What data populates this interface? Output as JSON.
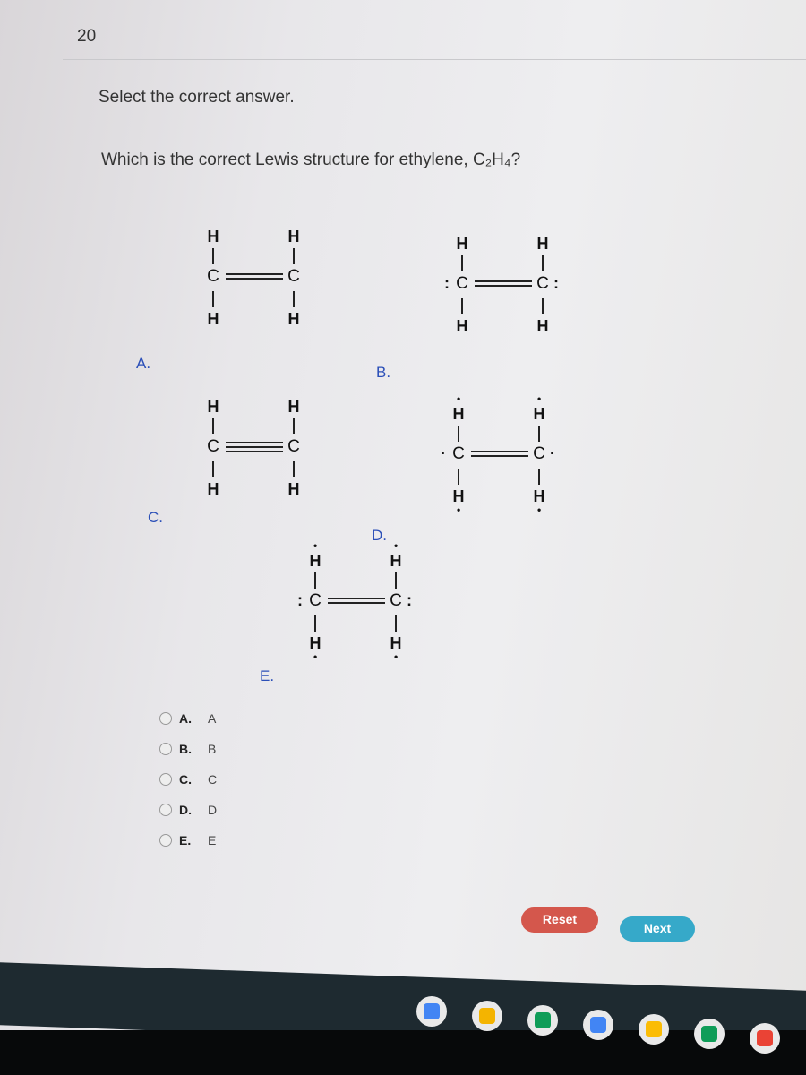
{
  "question_number": "20",
  "prompt": "Select the correct answer.",
  "question": "Which is the correct Lewis structure for ethylene, C₂H₄?",
  "structures": [
    {
      "label": "A.",
      "bond": "double",
      "left_dots": "",
      "right_dots": "",
      "h_dots": false
    },
    {
      "label": "B.",
      "bond": "double",
      "left_dots": ":",
      "right_dots": ":",
      "h_dots": false
    },
    {
      "label": "C.",
      "bond": "triple",
      "left_dots": "",
      "right_dots": "",
      "h_dots": false
    },
    {
      "label": "D.",
      "bond": "double",
      "left_dots": "·",
      "right_dots": "·",
      "h_dots": true
    },
    {
      "label": "E.",
      "bond": "double",
      "left_dots": ":",
      "right_dots": ":",
      "h_dots": true
    }
  ],
  "atoms": {
    "hydrogen": "H",
    "carbon": "C"
  },
  "answers": [
    {
      "label": "A.",
      "value": "A"
    },
    {
      "label": "B.",
      "value": "B"
    },
    {
      "label": "C.",
      "value": "C"
    },
    {
      "label": "D.",
      "value": "D"
    },
    {
      "label": "E.",
      "value": "E"
    }
  ],
  "buttons": {
    "reset": "Reset",
    "next": "Next"
  },
  "colors": {
    "reset": "#d4574c",
    "next": "#36a9c9",
    "option_label": "#2b4fb8"
  },
  "taskbar_apps": [
    {
      "name": "chrome-icon",
      "color": "#4285f4"
    },
    {
      "name": "slides-icon",
      "color": "#f4b400"
    },
    {
      "name": "classroom-icon",
      "color": "#0f9d58"
    },
    {
      "name": "docs-icon",
      "color": "#4285f4"
    },
    {
      "name": "drive-icon",
      "color": "#fbbc05"
    },
    {
      "name": "sheets-icon",
      "color": "#0f9d58"
    },
    {
      "name": "gmail-icon",
      "color": "#ea4335"
    }
  ]
}
